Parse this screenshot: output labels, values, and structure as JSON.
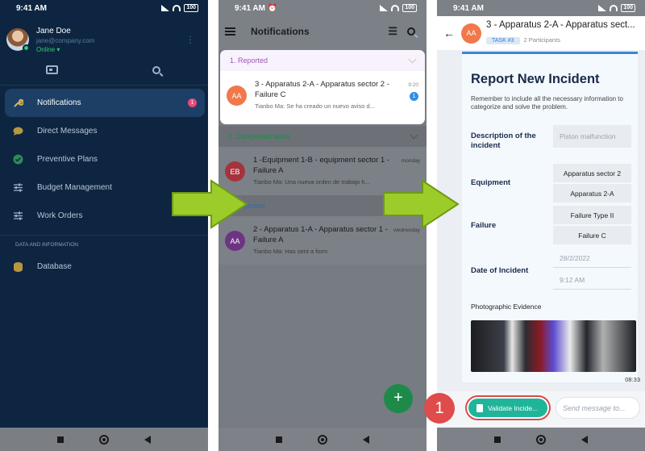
{
  "status_bar": {
    "time": "9:41 AM",
    "battery": "100"
  },
  "phone1": {
    "user": {
      "name": "Jane Doe",
      "email": "jane@company.com",
      "status": "Online"
    },
    "menu": [
      {
        "label": "Notifications",
        "icon": "wrench-icon",
        "badge": "1",
        "active": true
      },
      {
        "label": "Direct Messages",
        "icon": "chat-bubble-icon"
      },
      {
        "label": "Preventive Plans",
        "icon": "shield-check-icon"
      },
      {
        "label": "Budget Management",
        "icon": "sliders-icon"
      },
      {
        "label": "Work Orders",
        "icon": "sliders-icon"
      }
    ],
    "section_label": "DATA AND INFORMATION",
    "database_label": "Database"
  },
  "phone2": {
    "title": "Notifications",
    "sections": [
      {
        "label": "1. Reported",
        "color": "#9b59b6",
        "item": {
          "avatar": "AA",
          "avatar_color": "#f0784a",
          "title": "3 - Apparatus 2-A - Apparatus sector 2 - Failure C",
          "sub": "Tianbo Ma: Se ha creado un nuevo aviso d...",
          "time": "9:20",
          "badge": "1"
        }
      },
      {
        "label": "3. Completed tasks",
        "color": "#2ecc71",
        "item": {
          "avatar": "EB",
          "avatar_color": "#d64550",
          "title": "1 -Equipment 1-B - equipment sector 1 - Failure A",
          "sub": "Tianbo Ma: Una nueva orden de trabajo h...",
          "time": "monday"
        }
      },
      {
        "label": "4. Rejected",
        "color": "#3a86d6",
        "item": {
          "avatar": "AA",
          "avatar_color": "#8e44ad",
          "title": "2 - Apparatus 1-A - Apparatus sector 1 - Failure A",
          "sub": "Tianbo Ma: Has sent a form",
          "time": "wednesday"
        }
      }
    ],
    "fab": "+"
  },
  "phone3": {
    "avatar": "AA",
    "title": "3 - Apparatus 2-A - Apparatus sect...",
    "task": "TASK #3",
    "participants": "2 Participants",
    "form": {
      "title": "Report New Incident",
      "desc": "Remember to include all the necessary information to categorize and solve the problem.",
      "desc_label": "Description of the incident",
      "desc_placeholder": "Piston malfunction",
      "equipment_label": "Equipment",
      "equipment_values": [
        "Apparatus sector 2",
        "Apparatus 2-A"
      ],
      "failure_label": "Failure",
      "failure_values": [
        "Failure Type II",
        "Failure C"
      ],
      "date_label": "Date of Incident",
      "date": "28/2/2022",
      "time": "9:12 AM",
      "photo_label": "Photographic Evidence",
      "timestamp": "08:33"
    },
    "validate_btn": "Validate Incide...",
    "message_placeholder": "Send message to...",
    "step_number": "1"
  }
}
